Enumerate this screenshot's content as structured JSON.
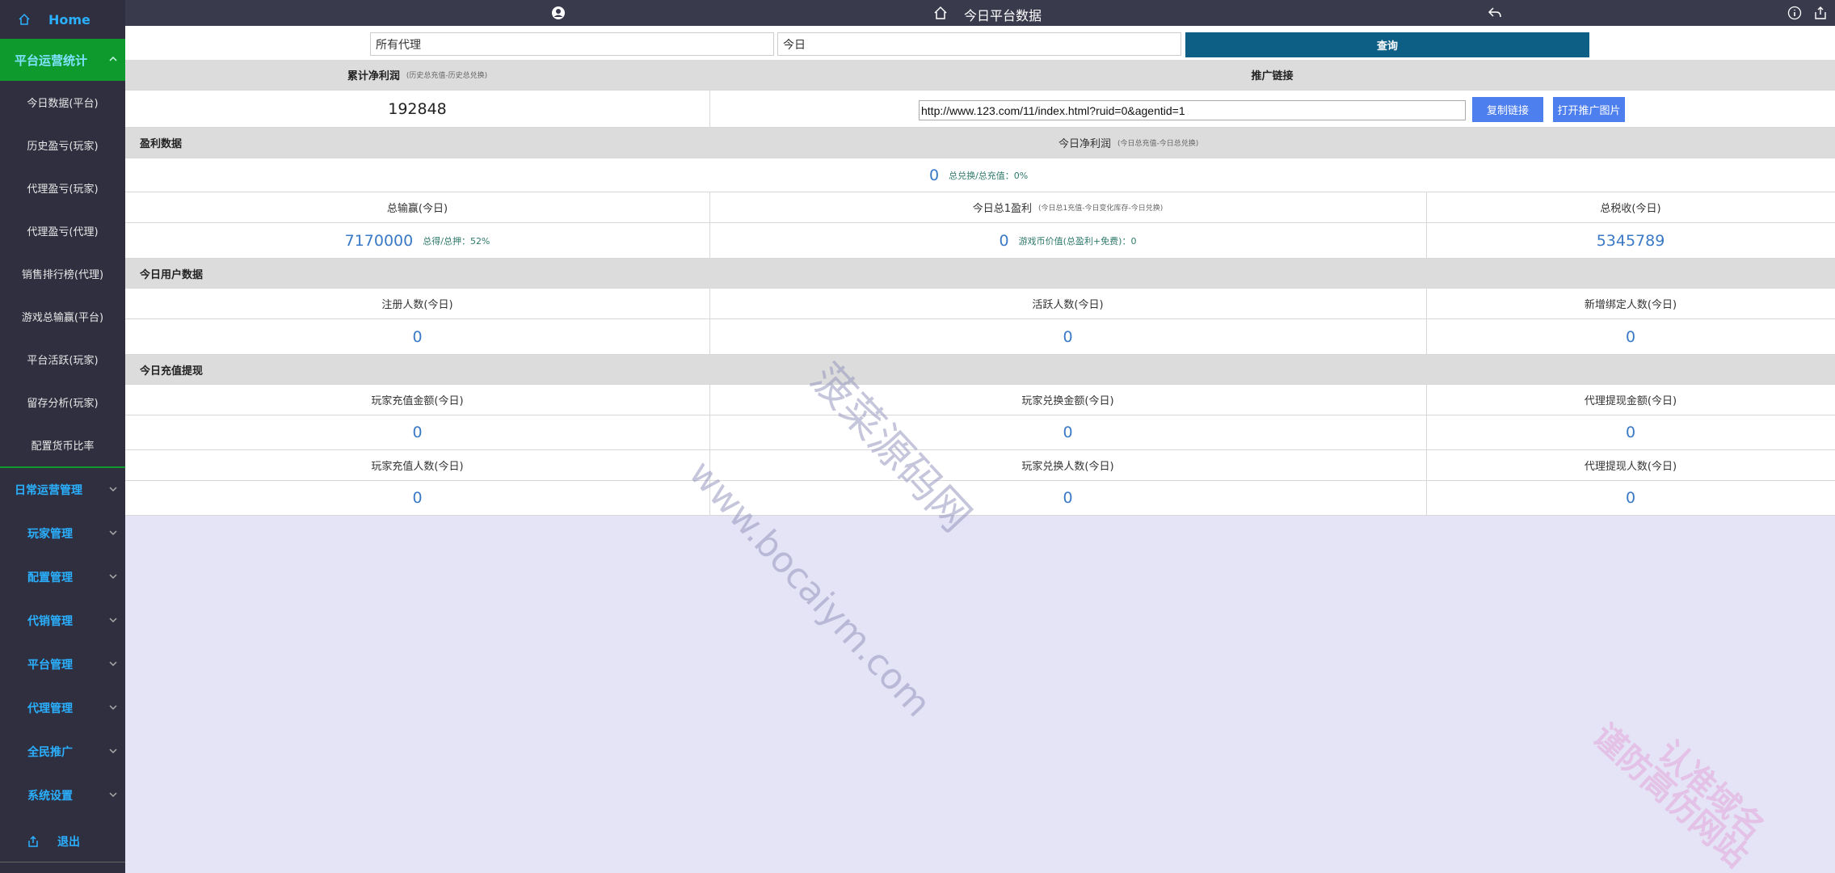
{
  "sidebar": {
    "home_label": "Home",
    "active_group": "平台运营统计",
    "sub_items": [
      "今日数据(平台)",
      "历史盈亏(玩家)",
      "代理盈亏(玩家)",
      "代理盈亏(代理)",
      "销售排行榜(代理)",
      "游戏总输赢(平台)",
      "平台活跃(玩家)",
      "留存分析(玩家)",
      "配置货币比率"
    ],
    "groups": [
      "日常运营管理",
      "玩家管理",
      "配置管理",
      "代销管理",
      "平台管理",
      "代理管理",
      "全民推广",
      "系统设置"
    ],
    "logout_label": "退出"
  },
  "topbar": {
    "title": "今日平台数据"
  },
  "filter": {
    "agent_value": "所有代理",
    "date_value": "今日",
    "query_label": "查询"
  },
  "panel": {
    "cum_profit_label": "累计净利润",
    "cum_profit_note": "(历史总充值-历史总兑换)",
    "promo_label": "推广链接",
    "cum_profit_value": "192848",
    "promo_url": "http://www.123.com/11/index.html?ruid=0&agentid=1",
    "copy_label": "复制链接",
    "open_label": "打开推广图片",
    "profit_section": "盈利数据",
    "today_net_label": "今日净利润",
    "today_net_note": "(今日总充值-今日总兑换)",
    "today_net_value": "0",
    "today_net_ratio": "总兑换/总充值：0%",
    "total_winlose_label": "总输赢(今日)",
    "total_profit_label": "今日总1盈利",
    "total_profit_note": "(今日总1充值-今日变化库存-今日兑换)",
    "total_tax_label": "总税收(今日)",
    "total_winlose_value": "7170000",
    "total_winlose_ratio": "总得/总押：52%",
    "total_profit_value": "0",
    "total_profit_extra": "游戏币价值(总盈利+免费)：0",
    "total_tax_value": "5345789",
    "user_section": "今日用户数据",
    "reg_label": "注册人数(今日)",
    "active_label": "活跃人数(今日)",
    "bind_label": "新增绑定人数(今日)",
    "reg_value": "0",
    "active_value": "0",
    "bind_value": "0",
    "recharge_section": "今日充值提现",
    "p_recharge_amt_label": "玩家充值金额(今日)",
    "p_exchange_amt_label": "玩家兑换金额(今日)",
    "a_withdraw_amt_label": "代理提现金额(今日)",
    "p_recharge_amt_value": "0",
    "p_exchange_amt_value": "0",
    "a_withdraw_amt_value": "0",
    "p_recharge_cnt_label": "玩家充值人数(今日)",
    "p_exchange_cnt_label": "玩家兑换人数(今日)",
    "a_withdraw_cnt_label": "代理提现人数(今日)",
    "p_recharge_cnt_value": "0",
    "p_exchange_cnt_value": "0",
    "a_withdraw_cnt_value": "0"
  },
  "watermarks": {
    "site_text": "www.bocaiym.com",
    "site_cn": "菠菜源码网",
    "slogan": "认准域名",
    "slogan2": "谨防高仿网站"
  },
  "colors": {
    "sidebar_bg": "#2f2f3f",
    "active_green": "#0f9a2e",
    "link_blue": "#2ab0ff",
    "query_btn": "#0d5f86",
    "action_btn": "#4e7fee",
    "value_blue": "#3a79c5",
    "content_bg": "#e4e4f6"
  }
}
